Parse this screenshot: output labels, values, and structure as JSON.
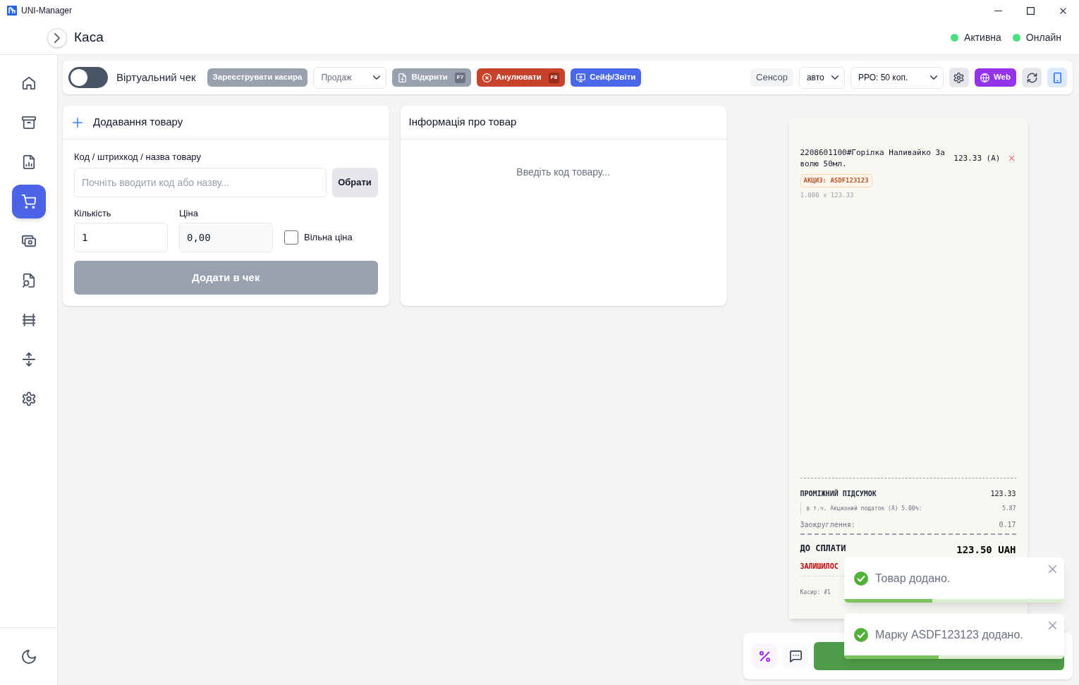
{
  "window": {
    "title": "UNI-Manager"
  },
  "header": {
    "title": "Каса",
    "statuses": [
      {
        "label": "Активна",
        "color": "#4ade80"
      },
      {
        "label": "Онлайн",
        "color": "#4ade80"
      }
    ]
  },
  "sidebar": {
    "items": [
      {
        "selected": false
      },
      {
        "selected": false
      },
      {
        "selected": false
      },
      {
        "selected": true
      },
      {
        "selected": false
      },
      {
        "selected": false
      },
      {
        "selected": false
      },
      {
        "selected": false
      },
      {
        "selected": false
      }
    ]
  },
  "toolbar": {
    "virtual_receipt": {
      "label": "Віртуальний чек",
      "on": false
    },
    "left": [
      {
        "kind": "button",
        "label": "Зареєструвати касира"
      },
      {
        "kind": "select",
        "value": "Продаж",
        "disabled": true
      },
      {
        "kind": "button",
        "label": "Відкрити",
        "shortcut": "F7"
      },
      {
        "kind": "button",
        "label": "Анулювати",
        "shortcut": "F8"
      },
      {
        "kind": "button",
        "label": "Сейф/Звіти"
      }
    ],
    "right": [
      {
        "kind": "label",
        "label": "Сенсор"
      },
      {
        "kind": "select",
        "value": "авто",
        "disabled": false
      },
      {
        "kind": "select",
        "value": "РРО: 50 коп.",
        "disabled": false
      },
      {
        "kind": "icon_button"
      },
      {
        "kind": "button",
        "label": "Web"
      },
      {
        "kind": "icon_button"
      },
      {
        "kind": "icon_button"
      }
    ]
  },
  "add_product": {
    "title": "Додавання товару",
    "code": {
      "label": "Код / штрихкод / назва товару",
      "placeholder": "Почніть вводити код або назву..."
    },
    "pick_button": "Обрати",
    "quantity": {
      "label": "Кількість",
      "value": "1"
    },
    "price": {
      "label": "Ціна",
      "value": "0,00"
    },
    "free_price": {
      "label": "Вільна ціна",
      "checked": false
    },
    "add_button": {
      "label": "Додати в чек",
      "disabled": true
    }
  },
  "product_info": {
    "title": "Інформація про товар",
    "empty_text": "Введіть код товару..."
  },
  "receipt": {
    "items": [
      {
        "name": "2208601100#Горілка Наливайко За волю 50мл.",
        "amount": "123.33 (А)",
        "excise": "АКЦИЗ: ASDF123123",
        "quantity_line": "1.000 x 123.33"
      }
    ],
    "subtotal": {
      "label": "ПРОМІЖНИЙ ПІДСУМОК",
      "value": "123.33"
    },
    "tax": {
      "label": "в т.ч. Акцизний податок (А) 5.00%:",
      "value": "5.87"
    },
    "rounding": {
      "label": "Заокруглення:",
      "value": "0.17"
    },
    "total": {
      "label": "ДО СПЛАТИ",
      "value": "123.50 UAH"
    },
    "remaining": {
      "label": "ЗАЛИШИЛОС"
    },
    "cashier": "Касир: #1"
  },
  "toasts": [
    {
      "text": "Товар додано.",
      "level": 0.4
    },
    {
      "text": "Марку ASDF123123 додано.",
      "level": 0.43
    }
  ]
}
